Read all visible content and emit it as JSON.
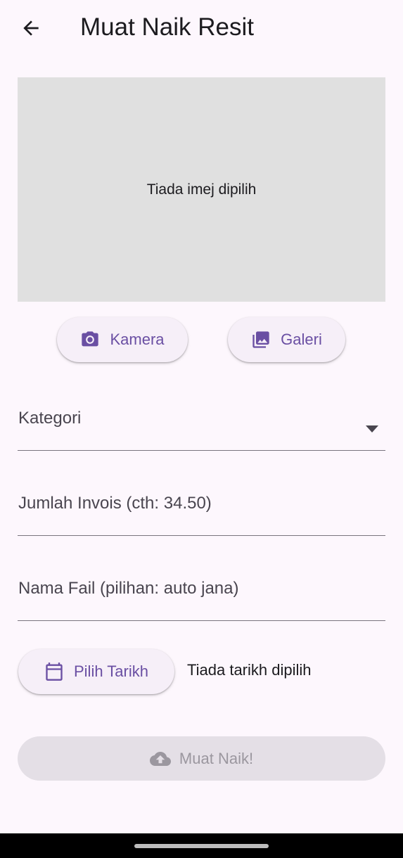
{
  "appbar": {
    "title": "Muat Naik Resit",
    "back_icon": "arrow-back-icon"
  },
  "preview": {
    "empty_text": "Tiada imej dipilih"
  },
  "image_source": {
    "camera": {
      "label": "Kamera",
      "icon": "camera-icon"
    },
    "gallery": {
      "label": "Galeri",
      "icon": "gallery-icon"
    }
  },
  "form": {
    "category": {
      "label": "Kategori",
      "value": ""
    },
    "amount": {
      "label": "Jumlah Invois (cth: 34.50)",
      "value": ""
    },
    "filename": {
      "label": "Nama Fail (pilihan: auto jana)",
      "value": ""
    }
  },
  "date": {
    "button_label": "Pilih Tarikh",
    "icon": "calendar-icon",
    "status": "Tiada tarikh dipilih"
  },
  "submit": {
    "label": "Muat Naik!",
    "icon": "cloud-upload-icon",
    "enabled": false
  },
  "colors": {
    "accent": "#6a4fa3",
    "background": "#fdf7fd",
    "preview_bg": "#e0e0e0",
    "disabled_bg": "#e4dfe6"
  }
}
